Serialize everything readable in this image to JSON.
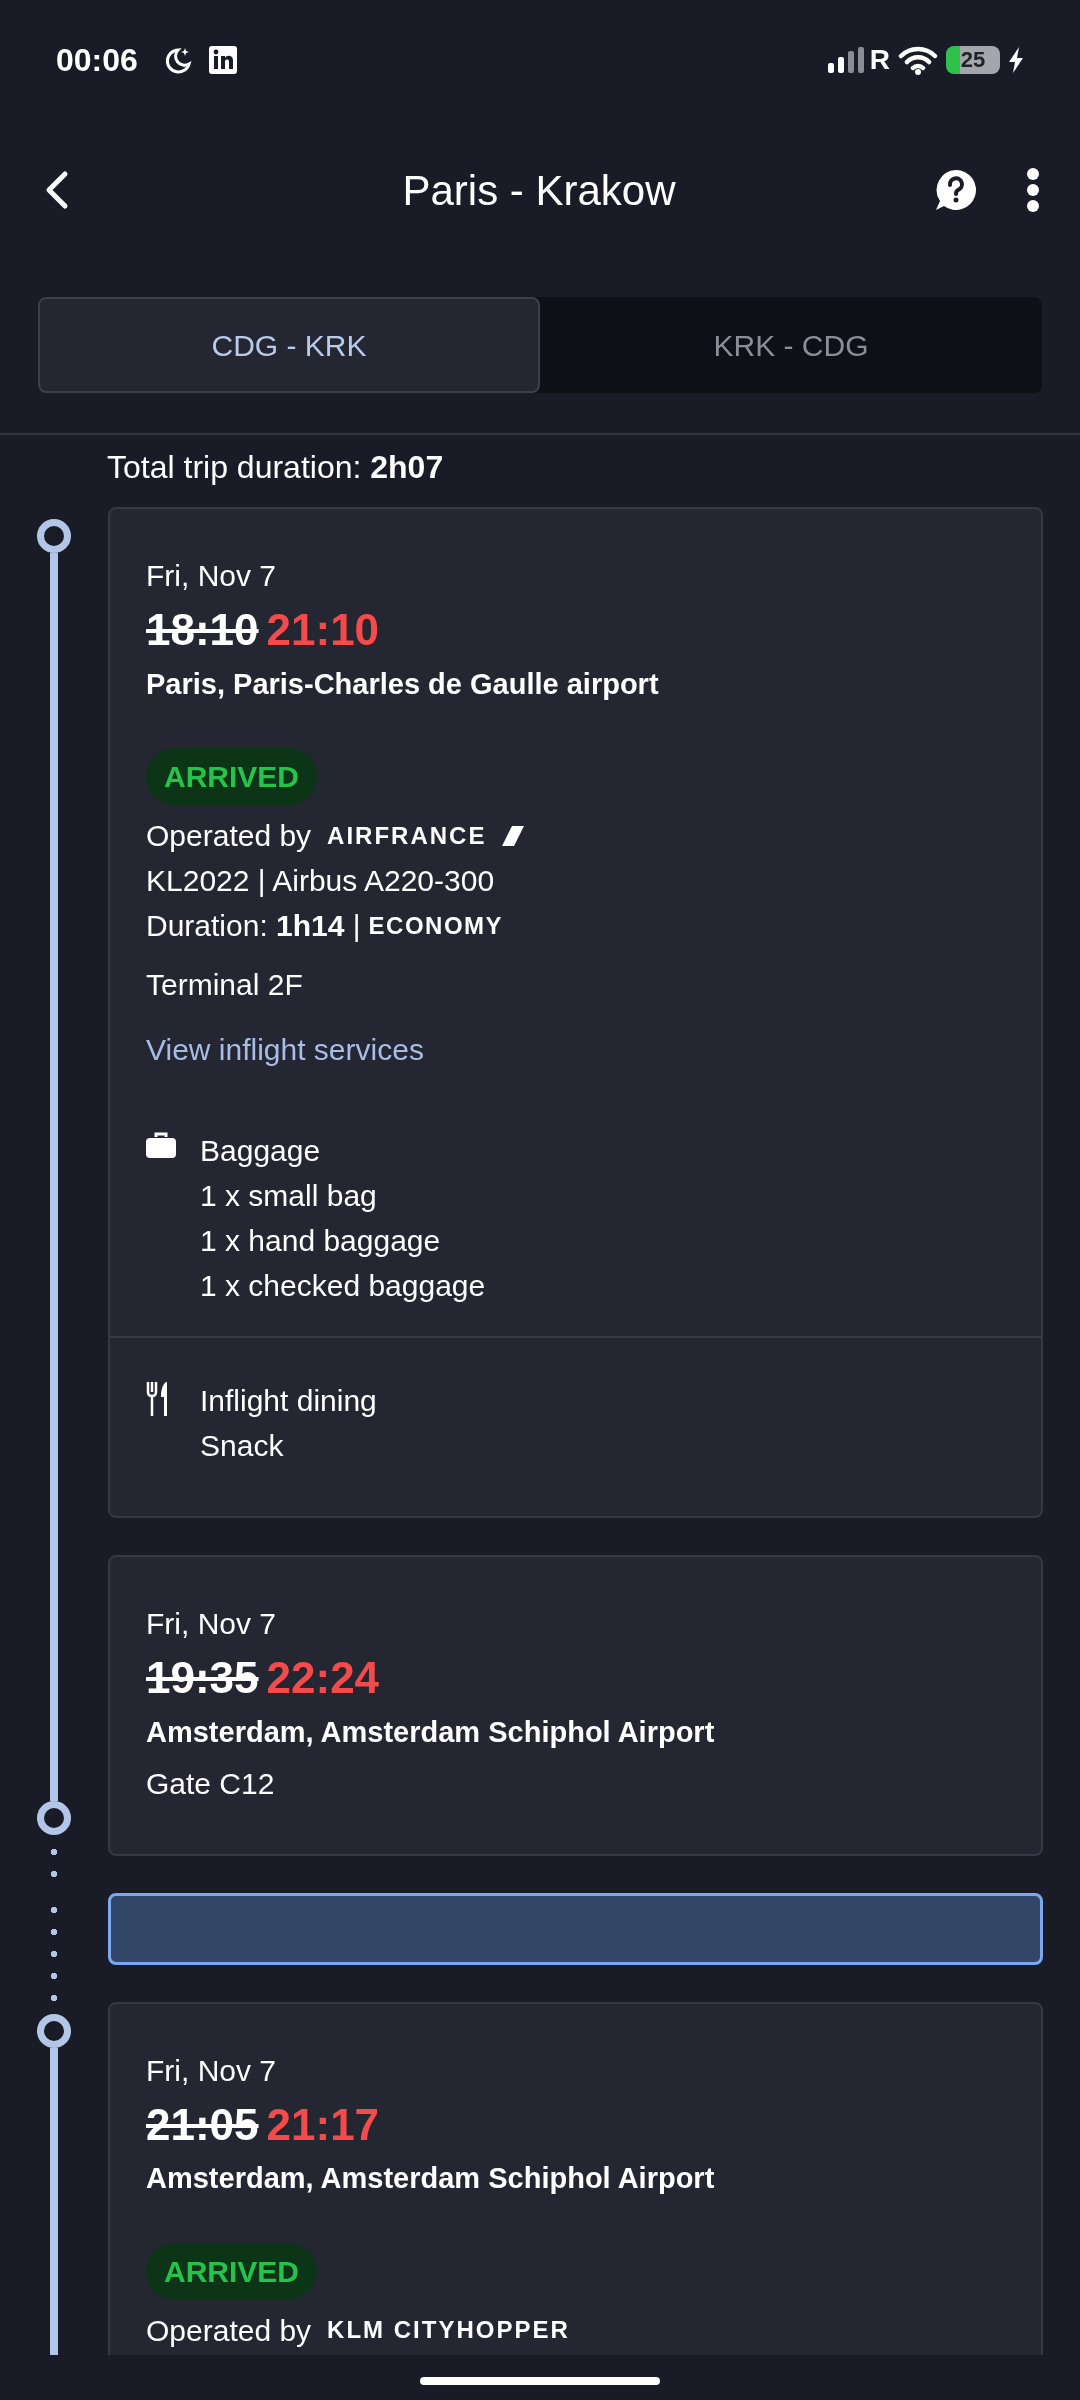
{
  "status_bar": {
    "time": "00:06",
    "network": "R",
    "battery": "25"
  },
  "header": {
    "title": "Paris - Krakow"
  },
  "tabs": [
    {
      "label": "CDG - KRK",
      "selected": true
    },
    {
      "label": "KRK - CDG",
      "selected": false
    }
  ],
  "total_trip": "Total trip duration: **2h07**",
  "timeline": [
    {
      "kind": "departure",
      "date": "Fri, Nov 7",
      "scheduled_time": "18:10",
      "actual_time": "21:10",
      "airport": "Paris, Paris-Charles de Gaulle airport",
      "status": "ARRIVED",
      "operated_by": "Operated by",
      "operator": "AIRFRANCE",
      "flight": "KL2022 | Airbus A220-300",
      "duration": "Duration: **1h14** |",
      "cabin": "ECONOMY",
      "terminal": "Terminal 2F",
      "link": "View inflight services",
      "sections": [
        {
          "kind": "baggage",
          "title": "Baggage",
          "items": [
            "1 x small bag",
            "1 x hand baggage",
            "1 x checked baggage"
          ]
        },
        {
          "kind": "dining",
          "title": "Inflight dining",
          "items": [
            "Snack"
          ]
        }
      ]
    },
    {
      "kind": "arrival",
      "date": "Fri, Nov 7",
      "scheduled_time": "19:35",
      "actual_time": "22:24",
      "airport": "Amsterdam, Amsterdam Schiphol Airport",
      "gate": "Gate C12"
    },
    {
      "kind": "connection"
    },
    {
      "kind": "departure",
      "date": "Fri, Nov 7",
      "scheduled_time": "21:05",
      "actual_time": "21:17",
      "airport": "Amsterdam, Amsterdam Schiphol Airport",
      "status": "ARRIVED",
      "operated_by": "Operated by",
      "operator": "KLM CITYHOPPER"
    }
  ]
}
